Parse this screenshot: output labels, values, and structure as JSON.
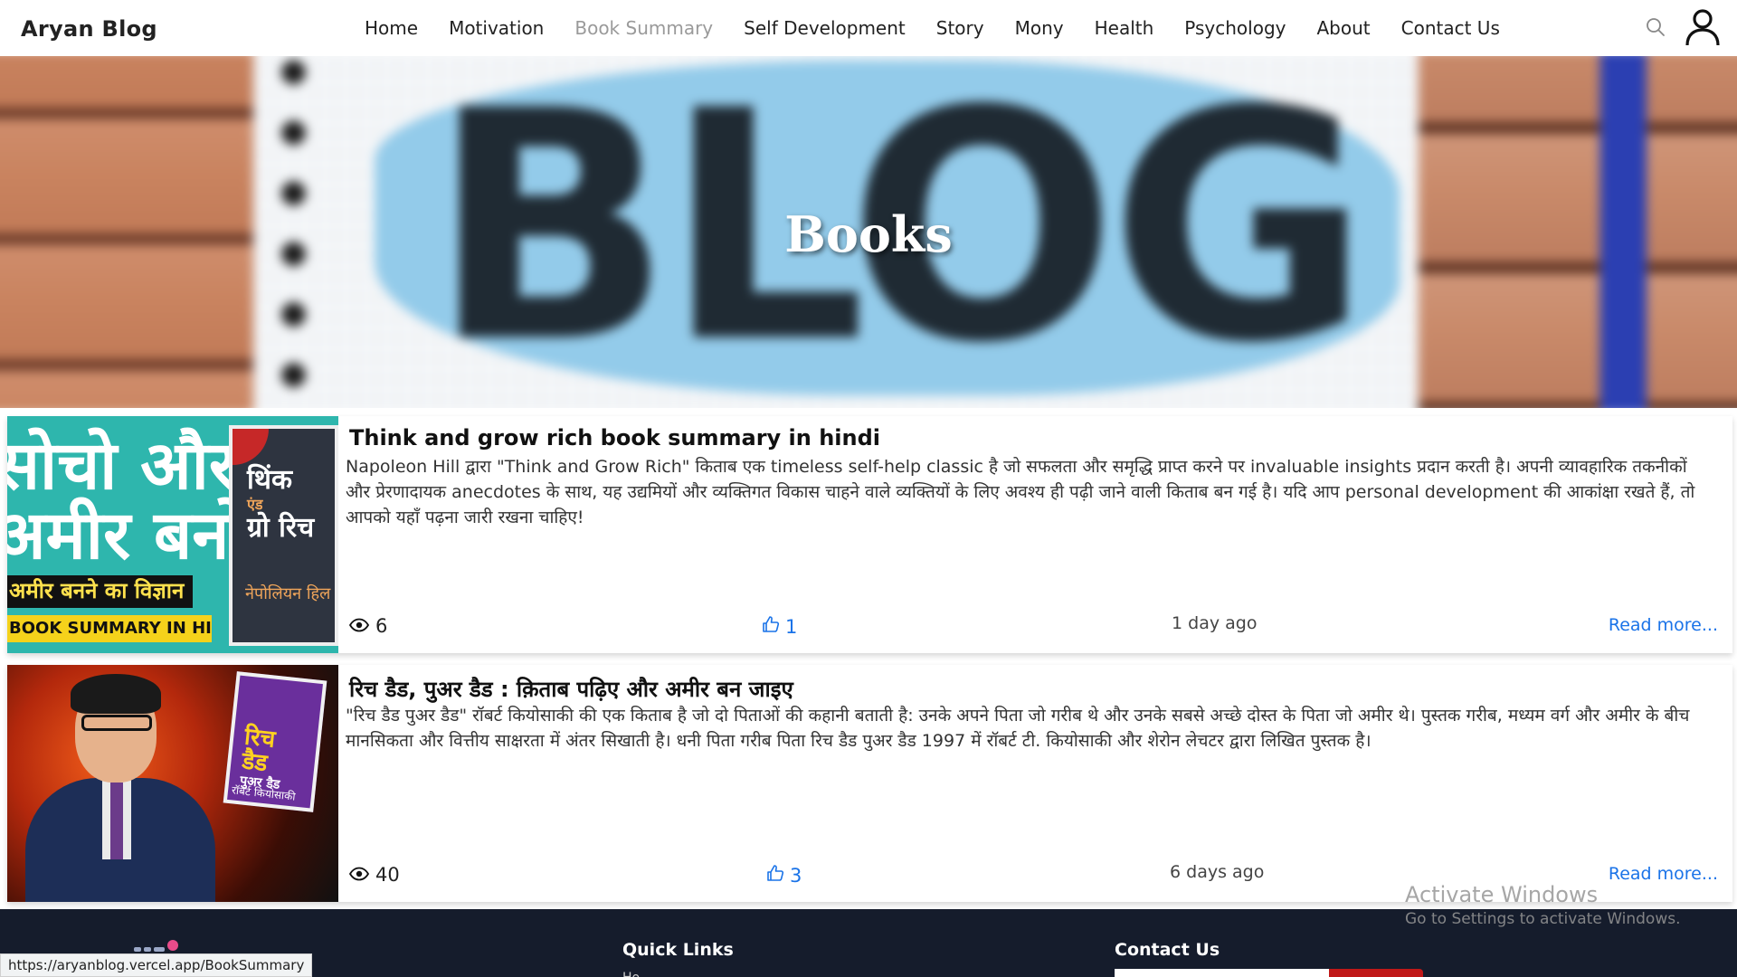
{
  "navbar": {
    "brand": "Aryan Blog",
    "links": [
      "Home",
      "Motivation",
      "Book Summary",
      "Self Development",
      "Story",
      "Mony",
      "Health",
      "Psychology",
      "About",
      "Contact Us"
    ],
    "active": "Book Summary",
    "icons": [
      "search-icon",
      "user-icon"
    ]
  },
  "hero": {
    "title": "Books",
    "background_word": "BLOG"
  },
  "posts": [
    {
      "title": "Think and grow rich book summary in hindi",
      "description": "Napoleon Hill द्वारा \"Think and Grow Rich\" किताब एक timeless self-help classic है जो सफलता और समृद्धि प्राप्त करने पर invaluable insights प्रदान करती है। अपनी व्यावहारिक तकनीकों और प्रेरणादायक anecdotes के साथ, यह उद्यमियों और व्यक्तिगत विकास चाहने वाले व्यक्तियों के लिए अवश्य ही पढ़ी जाने वाली किताब बन गई है। यदि आप personal development की आकांक्षा रखते हैं, तो आपको यहाँ पढ़ना जारी रखना चाहिए!",
      "views": "6",
      "likes": "1",
      "time": "1 day ago",
      "read_more": "Read more...",
      "thumbnail": {
        "line1": "सोचो और",
        "line2": "अमीर बनो",
        "band": "अमीर बनने का विज्ञान",
        "banner": "BOOK SUMMARY IN HINDI",
        "book_title_1": "थिंक",
        "book_title_2": "एंड",
        "book_title_3": "ग्रो रिच",
        "book_author": "नेपोलियन हिल"
      }
    },
    {
      "title": "रिच डैड, पुअर डैड : क़िताब पढ़िए और अमीर बन जाइए",
      "description": "\"रिच डैड पुअर डैड\" रॉबर्ट कियोसाकी की एक किताब है जो दो पिताओं की कहानी बताती है: उनके अपने पिता जो गरीब थे और उनके सबसे अच्छे दोस्त के पिता जो अमीर थे। पुस्तक गरीब, मध्यम वर्ग और अमीर के बीच मानसिकता और वित्तीय साक्षरता में अंतर सिखाती है। धनी पिता गरीब पिता रिच डैड पुअर डैड 1997 में रॉबर्ट टी. कियोसाकी और शेरोन लेचटर द्वारा लिखित पुस्तक है।",
      "views": "40",
      "likes": "3",
      "time": "6 days ago",
      "read_more": "Read more...",
      "thumbnail": {
        "book_title_1": "रिच",
        "book_title_2": "डैड",
        "book_title_3": "पुअर डैड",
        "book_author": "रॉबर्ट कियोसाकी"
      }
    }
  ],
  "footer": {
    "quick_links_heading": "Quick Links",
    "quick_links_first": "Ho",
    "contact_heading": "Contact Us"
  },
  "status_bar": {
    "url": "https://aryanblog.vercel.app/BookSummary"
  },
  "watermark": {
    "title": "Activate Windows",
    "subtitle": "Go to Settings to activate Windows."
  },
  "colors": {
    "accent_blue": "#1a73e8",
    "active_nav": "#9a9a9a",
    "footer_bg": "#151c2c",
    "footer_button": "#c01818"
  }
}
